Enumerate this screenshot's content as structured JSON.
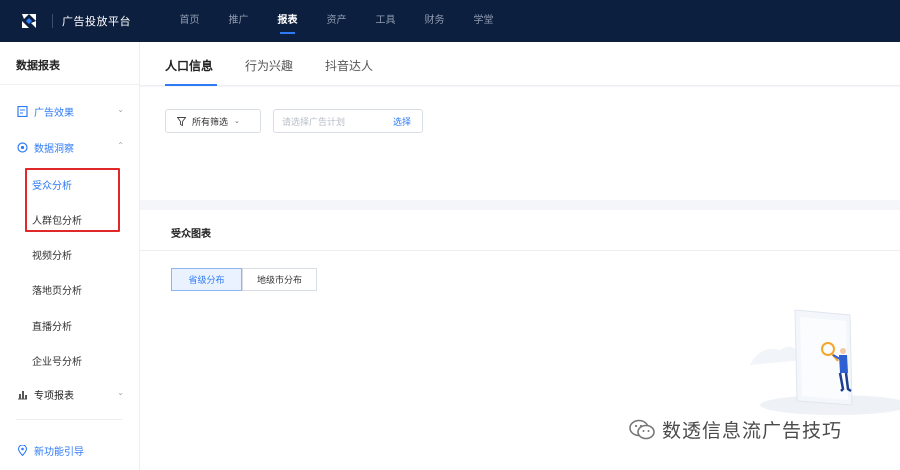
{
  "header": {
    "brand": "广告投放平台",
    "nav": [
      "首页",
      "推广",
      "报表",
      "资产",
      "工具",
      "财务",
      "学堂"
    ],
    "active_nav": "报表"
  },
  "sidebar": {
    "title": "数据报表",
    "groups": [
      {
        "label": "广告效果",
        "icon": "report-icon",
        "expanded": false
      },
      {
        "label": "数据洞察",
        "icon": "insight-icon",
        "expanded": true
      },
      {
        "label": "专项报表",
        "icon": "bar-chart-icon",
        "expanded": false
      },
      {
        "label": "新功能引导",
        "icon": "location-pin-icon"
      }
    ],
    "items": [
      "受众分析",
      "人群包分析",
      "视频分析",
      "落地页分析",
      "直播分析",
      "企业号分析"
    ],
    "active_item": "受众分析",
    "highlight_color": "#e02828"
  },
  "main": {
    "tabs": [
      "人口信息",
      "行为兴趣",
      "抖音达人"
    ],
    "active_tab": "人口信息",
    "filter": {
      "label": "所有筛选",
      "icon": "filter-icon"
    },
    "plan_input": {
      "placeholder": "请选择广告计划",
      "action": "选择"
    },
    "card": {
      "title": "受众图表",
      "segments": [
        "省级分布",
        "地级市分布"
      ],
      "active_segment": "省级分布"
    }
  },
  "watermark": {
    "text": "数透信息流广告技巧",
    "icon": "wechat-icon"
  },
  "colors": {
    "nav_bg": "#0d1f3f",
    "accent": "#2f7bf5",
    "highlight": "#e02828"
  }
}
